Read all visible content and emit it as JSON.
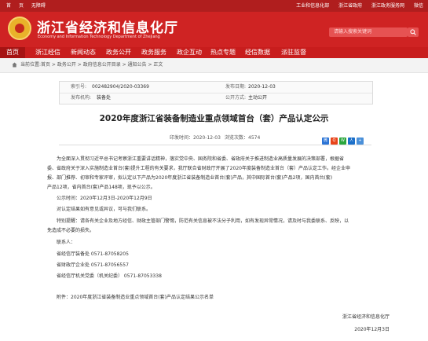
{
  "topbar": {
    "left": [
      "首",
      "页",
      "无障碍"
    ],
    "right": [
      "工业和信息化部",
      "浙江省政府",
      "浙江政务服务网",
      "微信"
    ]
  },
  "header": {
    "title_cn": "浙江省经济和信息化厅",
    "title_en": "Economy and Information Technology Department of Zhejiang",
    "search_placeholder": "请输入搜索关键词"
  },
  "nav": [
    "首页",
    "浙江经信",
    "新闻动态",
    "政务公开",
    "政务服务",
    "政企互动",
    "热点专题",
    "经信数据",
    "派驻监督"
  ],
  "breadcrumb": "当前位置:首页 > 政务公开 > 政府信息公开目录 > 通知公告 > 正文",
  "meta": {
    "index_label": "索引号:",
    "index_value": "002482904/2020-03369",
    "date_label": "发布日期:",
    "date_value": "2020-12-03",
    "org_label": "发布机构:",
    "org_value": "装备处",
    "scope_label": "公开方式:",
    "scope_value": "主动公开"
  },
  "document": {
    "title": "2020年度浙江省装备制造业重点领域首台（套）产品认定公示",
    "print_date_label": "印发时间：",
    "print_date": "2020-12-03",
    "views_label": "浏览次数：",
    "views": "4574",
    "paragraphs": [
      "为全面深入贯彻习近平总书记考察浙江重要讲话精神，落实党中央、国务院和省委、省政府关于推进制造业高质量发展的决策部署，根据省",
      "委、省政府关于深入实施制造业首台(套)提升工程的有关要求，我厅联合省财政厅开展了2020年度装备制造业首台（套）产品认定工作。经企业申",
      "报、部门推荐、初审和专家评审，拟认定以下产品为2020年度浙江省装备制造业首台(套)产品，其中国际首台(套)产品2项，国内首台(套)",
      "产品12项，省内首台(套)产品148项，现予以公示。",
      "公示时间：2020年12月3日-2020年12月9日",
      "对认定结果如有意见或异议，可与我们联系。",
      "特别提醒：请各有关企业及地方经信、财政主管部门警惕，防范有关信息被不法分子利用，如有发现异常情况，请及时与我委联系、反映，以",
      "免造成不必要的损失。",
      "联系人：",
      "省经信厅装备处      0571-87058205",
      "省财政厅企业处      0571-87056557",
      "省经信厅机关党委（机关纪委）   0571-87053338",
      "附件：2020年度浙江省装备制造业重点领域首台(套)产品认定结果公示名单"
    ],
    "signature_org": "浙江省经济和信息化厅",
    "signature_date": "2020年12月3日"
  },
  "share_icons": [
    "weibo-icon",
    "qzone-icon",
    "wechat-icon",
    "renren-icon",
    "more-icon"
  ],
  "colors": {
    "brand_red": "#cf2323",
    "topbar_red": "#b01e1e"
  }
}
